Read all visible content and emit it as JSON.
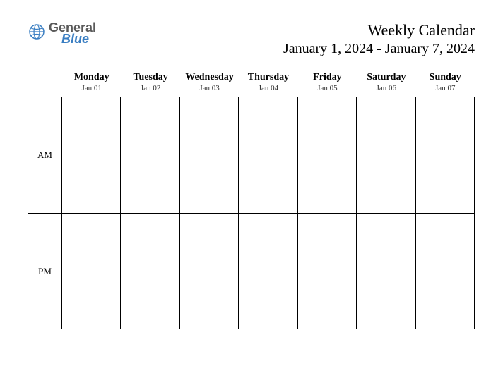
{
  "logo": {
    "text1": "General",
    "text2": "Blue"
  },
  "header": {
    "title": "Weekly Calendar",
    "date_range": "January 1, 2024 - January 7, 2024"
  },
  "days": [
    {
      "name": "Monday",
      "date": "Jan 01"
    },
    {
      "name": "Tuesday",
      "date": "Jan 02"
    },
    {
      "name": "Wednesday",
      "date": "Jan 03"
    },
    {
      "name": "Thursday",
      "date": "Jan 04"
    },
    {
      "name": "Friday",
      "date": "Jan 05"
    },
    {
      "name": "Saturday",
      "date": "Jan 06"
    },
    {
      "name": "Sunday",
      "date": "Jan 07"
    }
  ],
  "periods": {
    "am": "AM",
    "pm": "PM"
  }
}
